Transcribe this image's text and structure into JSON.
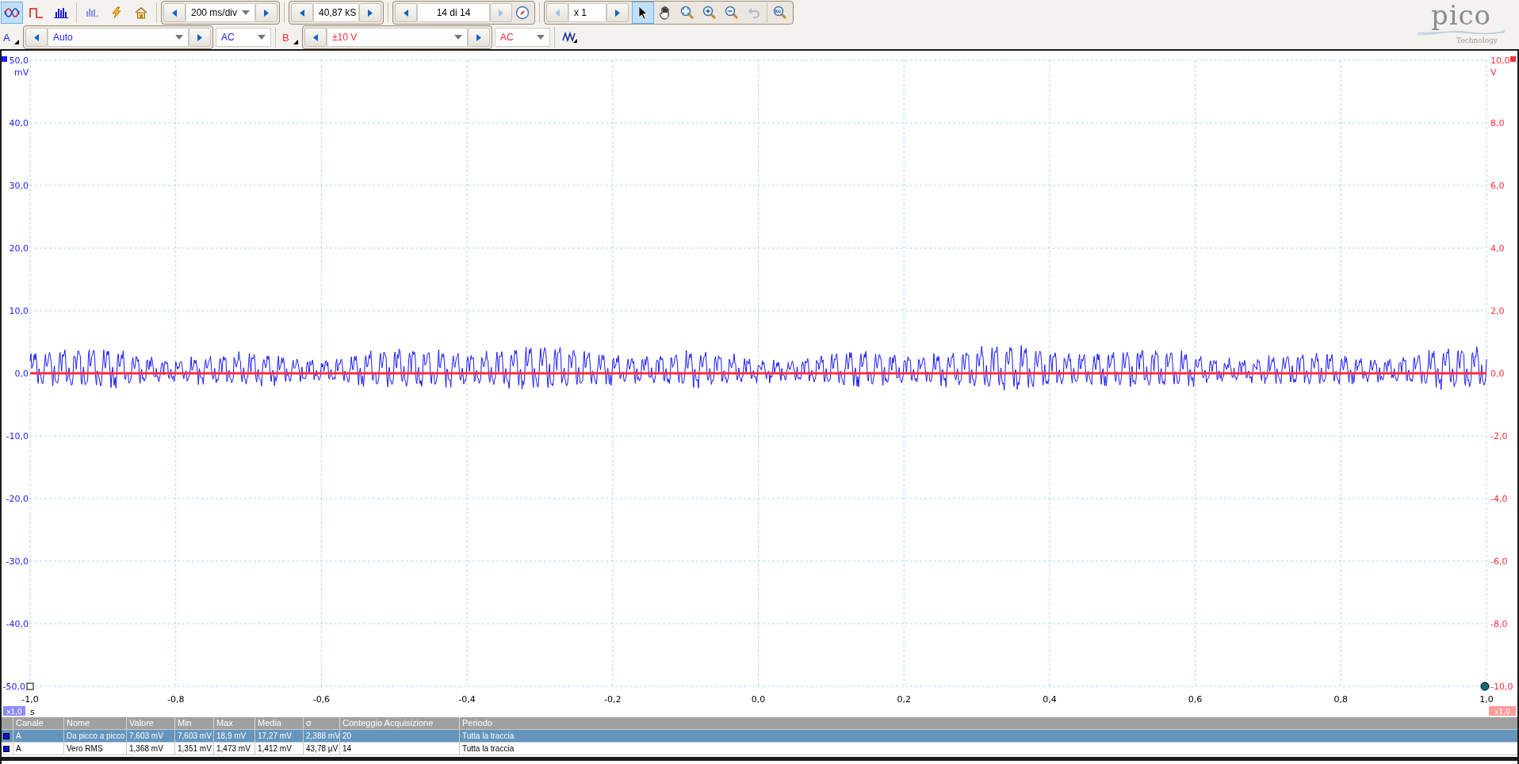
{
  "toolbar": {
    "tools": [
      {
        "kind": "scope",
        "selected": true,
        "disabled": false
      },
      {
        "kind": "persistence",
        "selected": false,
        "disabled": false
      },
      {
        "kind": "spectrum",
        "selected": false,
        "disabled": false
      },
      {
        "kind": "xy",
        "selected": false,
        "disabled": true
      },
      {
        "kind": "lightning",
        "selected": false,
        "disabled": false
      },
      {
        "kind": "home",
        "selected": false,
        "disabled": false
      }
    ],
    "timebase": {
      "value": "200 ms/div"
    },
    "samples": {
      "value": "40,87 kS"
    },
    "buffer": {
      "value": "14 di 14",
      "prev_disabled": false,
      "next_disabled": true
    },
    "zoom_factor": {
      "value": "x 1",
      "prev_disabled": true,
      "next_disabled": false
    },
    "view_tools": [
      {
        "kind": "pointer",
        "selected": true,
        "disabled": false
      },
      {
        "kind": "hand",
        "selected": false,
        "disabled": false
      },
      {
        "kind": "zoom-fit",
        "selected": false,
        "disabled": false
      },
      {
        "kind": "zoom-in",
        "selected": false,
        "disabled": false
      },
      {
        "kind": "zoom-out",
        "selected": false,
        "disabled": false
      },
      {
        "kind": "undo",
        "selected": false,
        "disabled": true
      },
      {
        "kind": "zoom-100",
        "selected": false,
        "disabled": false
      }
    ]
  },
  "channels": [
    {
      "label": "A",
      "color": "#1a1aff",
      "range": "Auto",
      "coupling": "AC"
    },
    {
      "label": "B",
      "color": "#ff2a3a",
      "range": "±10 V",
      "coupling": "AC"
    }
  ],
  "logo": {
    "name": "pico",
    "tagline": "Technology"
  },
  "plot": {
    "left_unit": "mV",
    "right_unit": "V",
    "x_unit": "s",
    "left_scale": "x1,0",
    "right_scale": "x1,0",
    "left_ticks": [
      "50,0",
      "40,0",
      "30,0",
      "20,0",
      "10,0",
      "0,0",
      "-10,0",
      "-20,0",
      "-30,0",
      "-40,0",
      "-50,0"
    ],
    "right_ticks": [
      "10,0",
      "8,0",
      "6,0",
      "4,0",
      "2,0",
      "0,0",
      "-2,0",
      "-4,0",
      "-6,0",
      "-8,0",
      "-10,0"
    ],
    "x_ticks": [
      "-1,0",
      "-0,8",
      "-0,6",
      "-0,4",
      "-0,2",
      "0,0",
      "0,2",
      "0,4",
      "0,6",
      "0,8",
      "1,0"
    ]
  },
  "measurements": {
    "columns": [
      "Canale",
      "Nome",
      "Valore",
      "Min",
      "Max",
      "Media",
      "σ",
      "Conteggio Acquisizione",
      "Periodo"
    ],
    "rows": [
      {
        "selected": true,
        "cells": [
          "A",
          "Da picco a picco",
          "7,603 mV",
          "7,603 mV",
          "18,9 mV",
          "17,27 mV",
          "2,388 mV",
          "20",
          "Tutta la traccia"
        ]
      },
      {
        "selected": false,
        "cells": [
          "A",
          "Vero RMS",
          "1,368 mV",
          "1,351 mV",
          "1,473 mV",
          "1,412 mV",
          "43,78 µV",
          "14",
          "Tutta la traccia"
        ]
      }
    ]
  }
}
